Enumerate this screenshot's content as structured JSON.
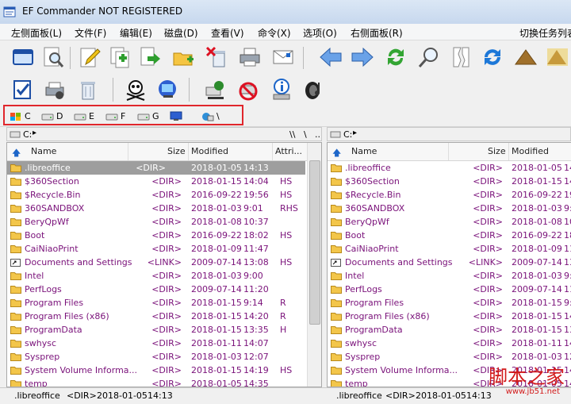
{
  "window": {
    "title": "EF Commander NOT REGISTERED"
  },
  "menu": [
    "左侧面板(L)",
    "文件(F)",
    "编辑(E)",
    "磁盘(D)",
    "查看(V)",
    "命令(X)",
    "选项(O)",
    "右侧面板(R)",
    "切换任务列表"
  ],
  "drives": [
    "C",
    "D",
    "E",
    "F",
    "G",
    "",
    "\\"
  ],
  "left": {
    "path": "C:",
    "nav": [
      "\\\\",
      "\\",
      ".."
    ],
    "columns": [
      "Name",
      "Size",
      "Modified",
      "Attri..."
    ],
    "rows": [
      {
        "name": ".libreoffice",
        "size": "<DIR>",
        "date": "2018-01-05",
        "time": "14:13",
        "attr": "",
        "selected": true
      },
      {
        "name": "$360Section",
        "size": "<DIR>",
        "date": "2018-01-15",
        "time": "14:04",
        "attr": "HS"
      },
      {
        "name": "$Recycle.Bin",
        "size": "<DIR>",
        "date": "2016-09-22",
        "time": "19:56",
        "attr": "HS"
      },
      {
        "name": "360SANDBOX",
        "size": "<DIR>",
        "date": "2018-01-03",
        "time": "9:01",
        "attr": "RHS"
      },
      {
        "name": "BeryQpWf",
        "size": "<DIR>",
        "date": "2018-01-08",
        "time": "10:37",
        "attr": ""
      },
      {
        "name": "Boot",
        "size": "<DIR>",
        "date": "2016-09-22",
        "time": "18:02",
        "attr": "HS"
      },
      {
        "name": "CaiNiaoPrint",
        "size": "<DIR>",
        "date": "2018-01-09",
        "time": "11:47",
        "attr": ""
      },
      {
        "name": "Documents and Settings",
        "size": "<LINK>",
        "date": "2009-07-14",
        "time": "13:08",
        "attr": "HS"
      },
      {
        "name": "Intel",
        "size": "<DIR>",
        "date": "2018-01-03",
        "time": "9:00",
        "attr": ""
      },
      {
        "name": "PerfLogs",
        "size": "<DIR>",
        "date": "2009-07-14",
        "time": "11:20",
        "attr": ""
      },
      {
        "name": "Program Files",
        "size": "<DIR>",
        "date": "2018-01-15",
        "time": "9:14",
        "attr": "R"
      },
      {
        "name": "Program Files (x86)",
        "size": "<DIR>",
        "date": "2018-01-15",
        "time": "14:20",
        "attr": "R"
      },
      {
        "name": "ProgramData",
        "size": "<DIR>",
        "date": "2018-01-15",
        "time": "13:35",
        "attr": "H"
      },
      {
        "name": "swhysc",
        "size": "<DIR>",
        "date": "2018-01-11",
        "time": "14:07",
        "attr": ""
      },
      {
        "name": "Sysprep",
        "size": "<DIR>",
        "date": "2018-01-03",
        "time": "12:07",
        "attr": ""
      },
      {
        "name": "System Volume Informa...",
        "size": "<DIR>",
        "date": "2018-01-15",
        "time": "14:19",
        "attr": "HS"
      },
      {
        "name": "temp",
        "size": "<DIR>",
        "date": "2018-01-05",
        "time": "14:35",
        "attr": ""
      }
    ]
  },
  "right": {
    "path": "C:",
    "columns": [
      "Name",
      "Size",
      "Modified"
    ],
    "rows": [
      {
        "name": ".libreoffice",
        "size": "<DIR>",
        "date": "2018-01-05",
        "time": "14"
      },
      {
        "name": "$360Section",
        "size": "<DIR>",
        "date": "2018-01-15",
        "time": "14"
      },
      {
        "name": "$Recycle.Bin",
        "size": "<DIR>",
        "date": "2016-09-22",
        "time": "19"
      },
      {
        "name": "360SANDBOX",
        "size": "<DIR>",
        "date": "2018-01-03",
        "time": "9:0"
      },
      {
        "name": "BeryQpWf",
        "size": "<DIR>",
        "date": "2018-01-08",
        "time": "10"
      },
      {
        "name": "Boot",
        "size": "<DIR>",
        "date": "2016-09-22",
        "time": "18"
      },
      {
        "name": "CaiNiaoPrint",
        "size": "<DIR>",
        "date": "2018-01-09",
        "time": "11"
      },
      {
        "name": "Documents and Settings",
        "size": "<LINK>",
        "date": "2009-07-14",
        "time": "13"
      },
      {
        "name": "Intel",
        "size": "<DIR>",
        "date": "2018-01-03",
        "time": "9:0"
      },
      {
        "name": "PerfLogs",
        "size": "<DIR>",
        "date": "2009-07-14",
        "time": "11"
      },
      {
        "name": "Program Files",
        "size": "<DIR>",
        "date": "2018-01-15",
        "time": "9:1"
      },
      {
        "name": "Program Files (x86)",
        "size": "<DIR>",
        "date": "2018-01-15",
        "time": "14"
      },
      {
        "name": "ProgramData",
        "size": "<DIR>",
        "date": "2018-01-15",
        "time": "13"
      },
      {
        "name": "swhysc",
        "size": "<DIR>",
        "date": "2018-01-11",
        "time": "14"
      },
      {
        "name": "Sysprep",
        "size": "<DIR>",
        "date": "2018-01-03",
        "time": "12"
      },
      {
        "name": "System Volume Informa...",
        "size": "<DIR>",
        "date": "2018-01-15",
        "time": "14"
      },
      {
        "name": "temp",
        "size": "<DIR>",
        "date": "2018-01-05",
        "time": "14"
      }
    ]
  },
  "status": {
    "left": {
      "name": ".libreoffice",
      "size": "<DIR>",
      "date": "2018-01-05",
      "time": "14:13"
    },
    "right": {
      "name": ".libreoffice",
      "size": "<DIR>",
      "date": "2018-01-05",
      "time": "14:13"
    }
  },
  "watermark": {
    "text": "脚本之家",
    "url": "www.jb51.net"
  },
  "colors": {
    "purple": "#7a127a",
    "highlight": "#e0262c",
    "selection": "#9e9e9e"
  }
}
